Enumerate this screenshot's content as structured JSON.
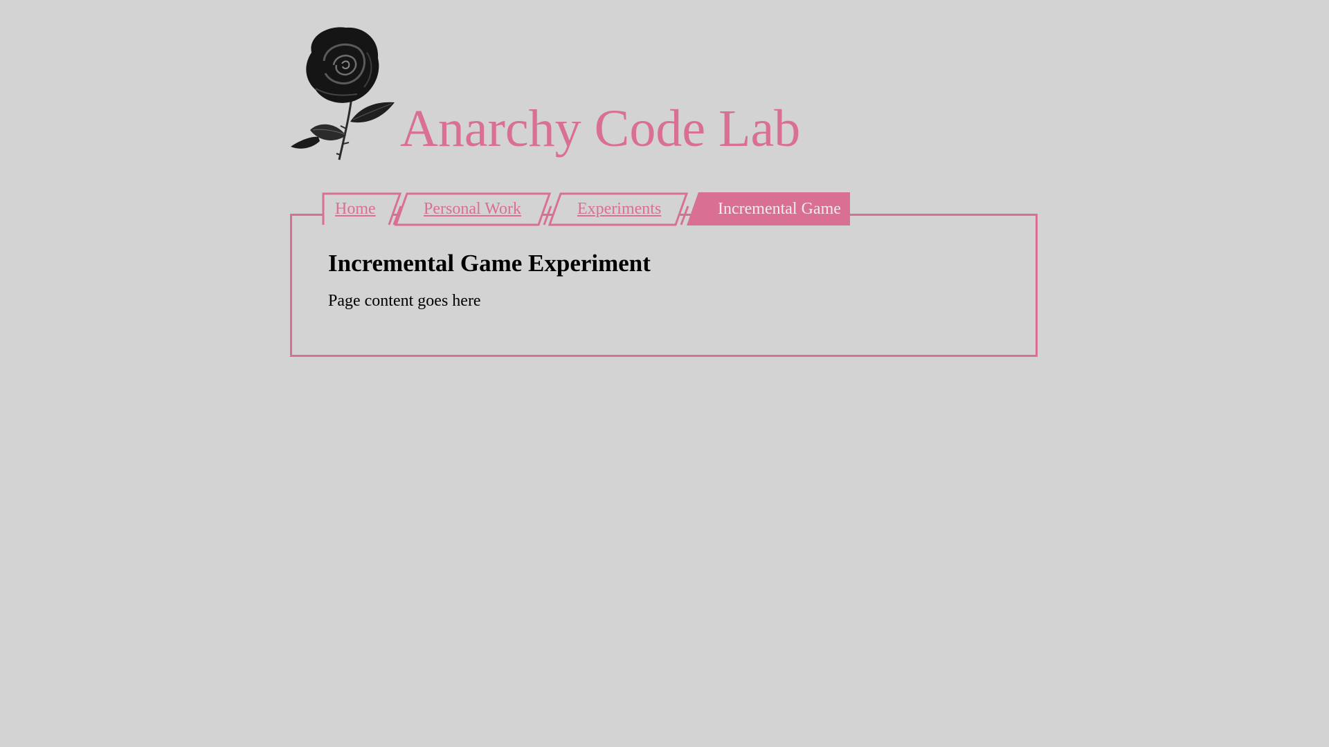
{
  "site": {
    "title": "Anarchy Code Lab"
  },
  "nav": {
    "tabs": [
      {
        "label": "Home",
        "active": false
      },
      {
        "label": "Personal Work",
        "active": false
      },
      {
        "label": "Experiments",
        "active": false
      },
      {
        "label": "Incremental Game",
        "active": true
      }
    ]
  },
  "main": {
    "heading": "Incremental Game Experiment",
    "body": "Page content goes here"
  },
  "colors": {
    "accent": "#d96f92",
    "background": "#d3d3d3",
    "active_tab_text": "#f5e9ee"
  },
  "icons": {
    "logo": "black-rose-icon"
  }
}
